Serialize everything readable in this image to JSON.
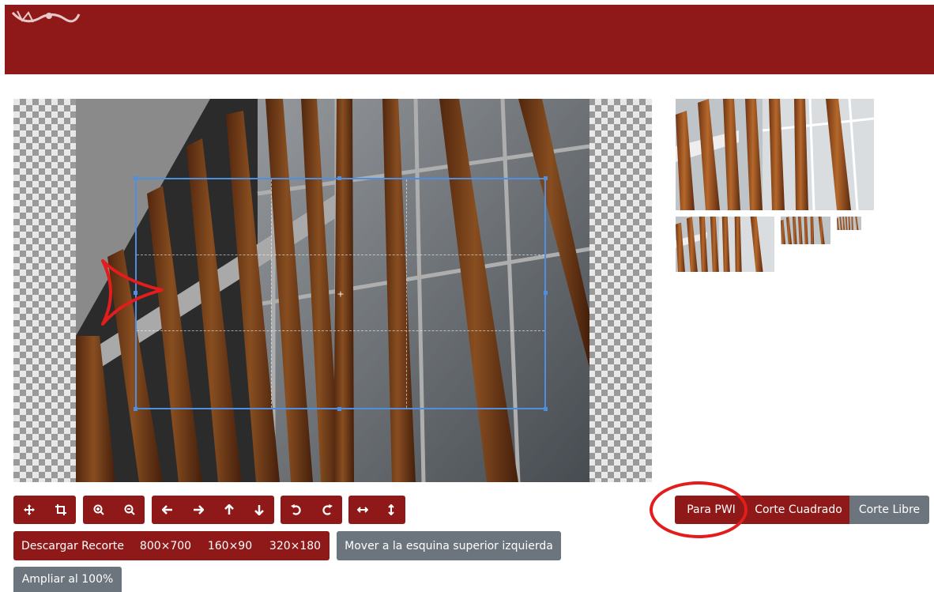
{
  "icons": [
    "move-icon",
    "crop-icon",
    "zoom-in-icon",
    "zoom-out-icon",
    "arrow-left-icon",
    "arrow-right-icon",
    "arrow-up-icon",
    "arrow-down-icon",
    "rotate-left-icon",
    "rotate-right-icon",
    "flip-horizontal-icon",
    "flip-vertical-icon"
  ],
  "actions": {
    "download_label": "Descargar Recorte",
    "size_800": "800×700",
    "size_160": "160×90",
    "size_320": "320×180",
    "move_top_left": "Mover a la esquina superior izquierda",
    "zoom_100": "Ampliar al 100%"
  },
  "aspect_tabs": {
    "pwi": "Para PWI",
    "square": "Corte Cuadrado",
    "free": "Corte Libre"
  },
  "colors": {
    "brand": "#8f1818",
    "secondary": "#6c757d",
    "crop_outline": "#4f8fe0",
    "annotation": "#e31c1c"
  }
}
